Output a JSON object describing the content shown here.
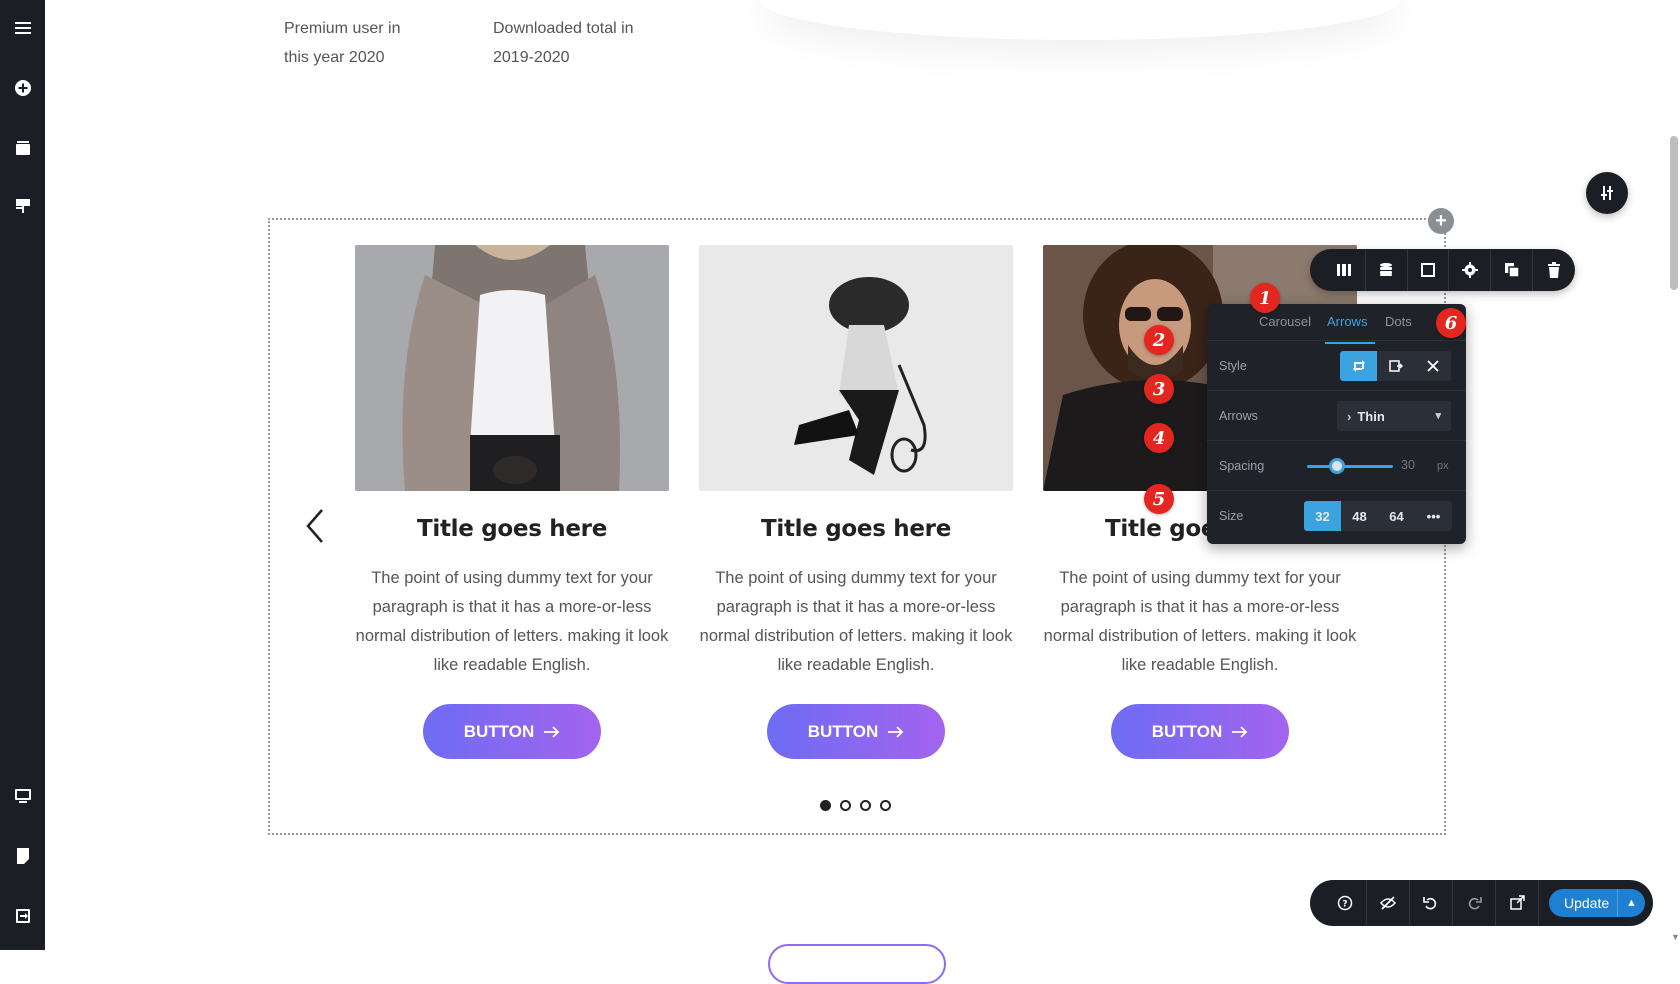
{
  "stats": [
    {
      "line1": "Premium user in",
      "line2": "this year 2020"
    },
    {
      "line1": "Downloaded total in",
      "line2": "2019-2020"
    }
  ],
  "sidebar": {
    "icons": [
      "menu-icon",
      "add-circle-icon",
      "layers-icon",
      "paint-roller-icon",
      "desktop-icon",
      "page-icon",
      "exit-icon"
    ]
  },
  "carousel": {
    "cards": [
      {
        "title": "Title goes here",
        "text": "The point of using dummy text for your paragraph is that it has a more-or-less normal distribution of letters. making it look like readable English.",
        "button": "BUTTON"
      },
      {
        "title": "Title goes here",
        "text": "The point of using dummy text for your paragraph is that it has a more-or-less normal distribution of letters. making it look like readable English.",
        "button": "BUTTON"
      },
      {
        "title": "Title goes here",
        "text": "The point of using dummy text for your paragraph is that it has a more-or-less normal distribution of letters. making it look like readable English.",
        "button": "BUTTON"
      }
    ],
    "dots": 4,
    "active_dot": 0
  },
  "panel": {
    "tabs": [
      "Carousel",
      "Arrows",
      "Dots"
    ],
    "active_tab": "Arrows",
    "style_label": "Style",
    "arrows_label": "Arrows",
    "arrows_value": "Thin",
    "spacing_label": "Spacing",
    "spacing_value": "30",
    "spacing_unit": "px",
    "size_label": "Size",
    "size_options": [
      "32",
      "48",
      "64",
      "•••"
    ],
    "size_selected": "32"
  },
  "badges": [
    "1",
    "2",
    "3",
    "4",
    "5",
    "6"
  ],
  "bottombar": {
    "update_label": "Update"
  },
  "colors": {
    "accent": "#3aa3e0",
    "badge": "#e3261f",
    "button_gradient_start": "#6d6cf3",
    "button_gradient_end": "#a463ef",
    "dark": "#1b1e24"
  }
}
